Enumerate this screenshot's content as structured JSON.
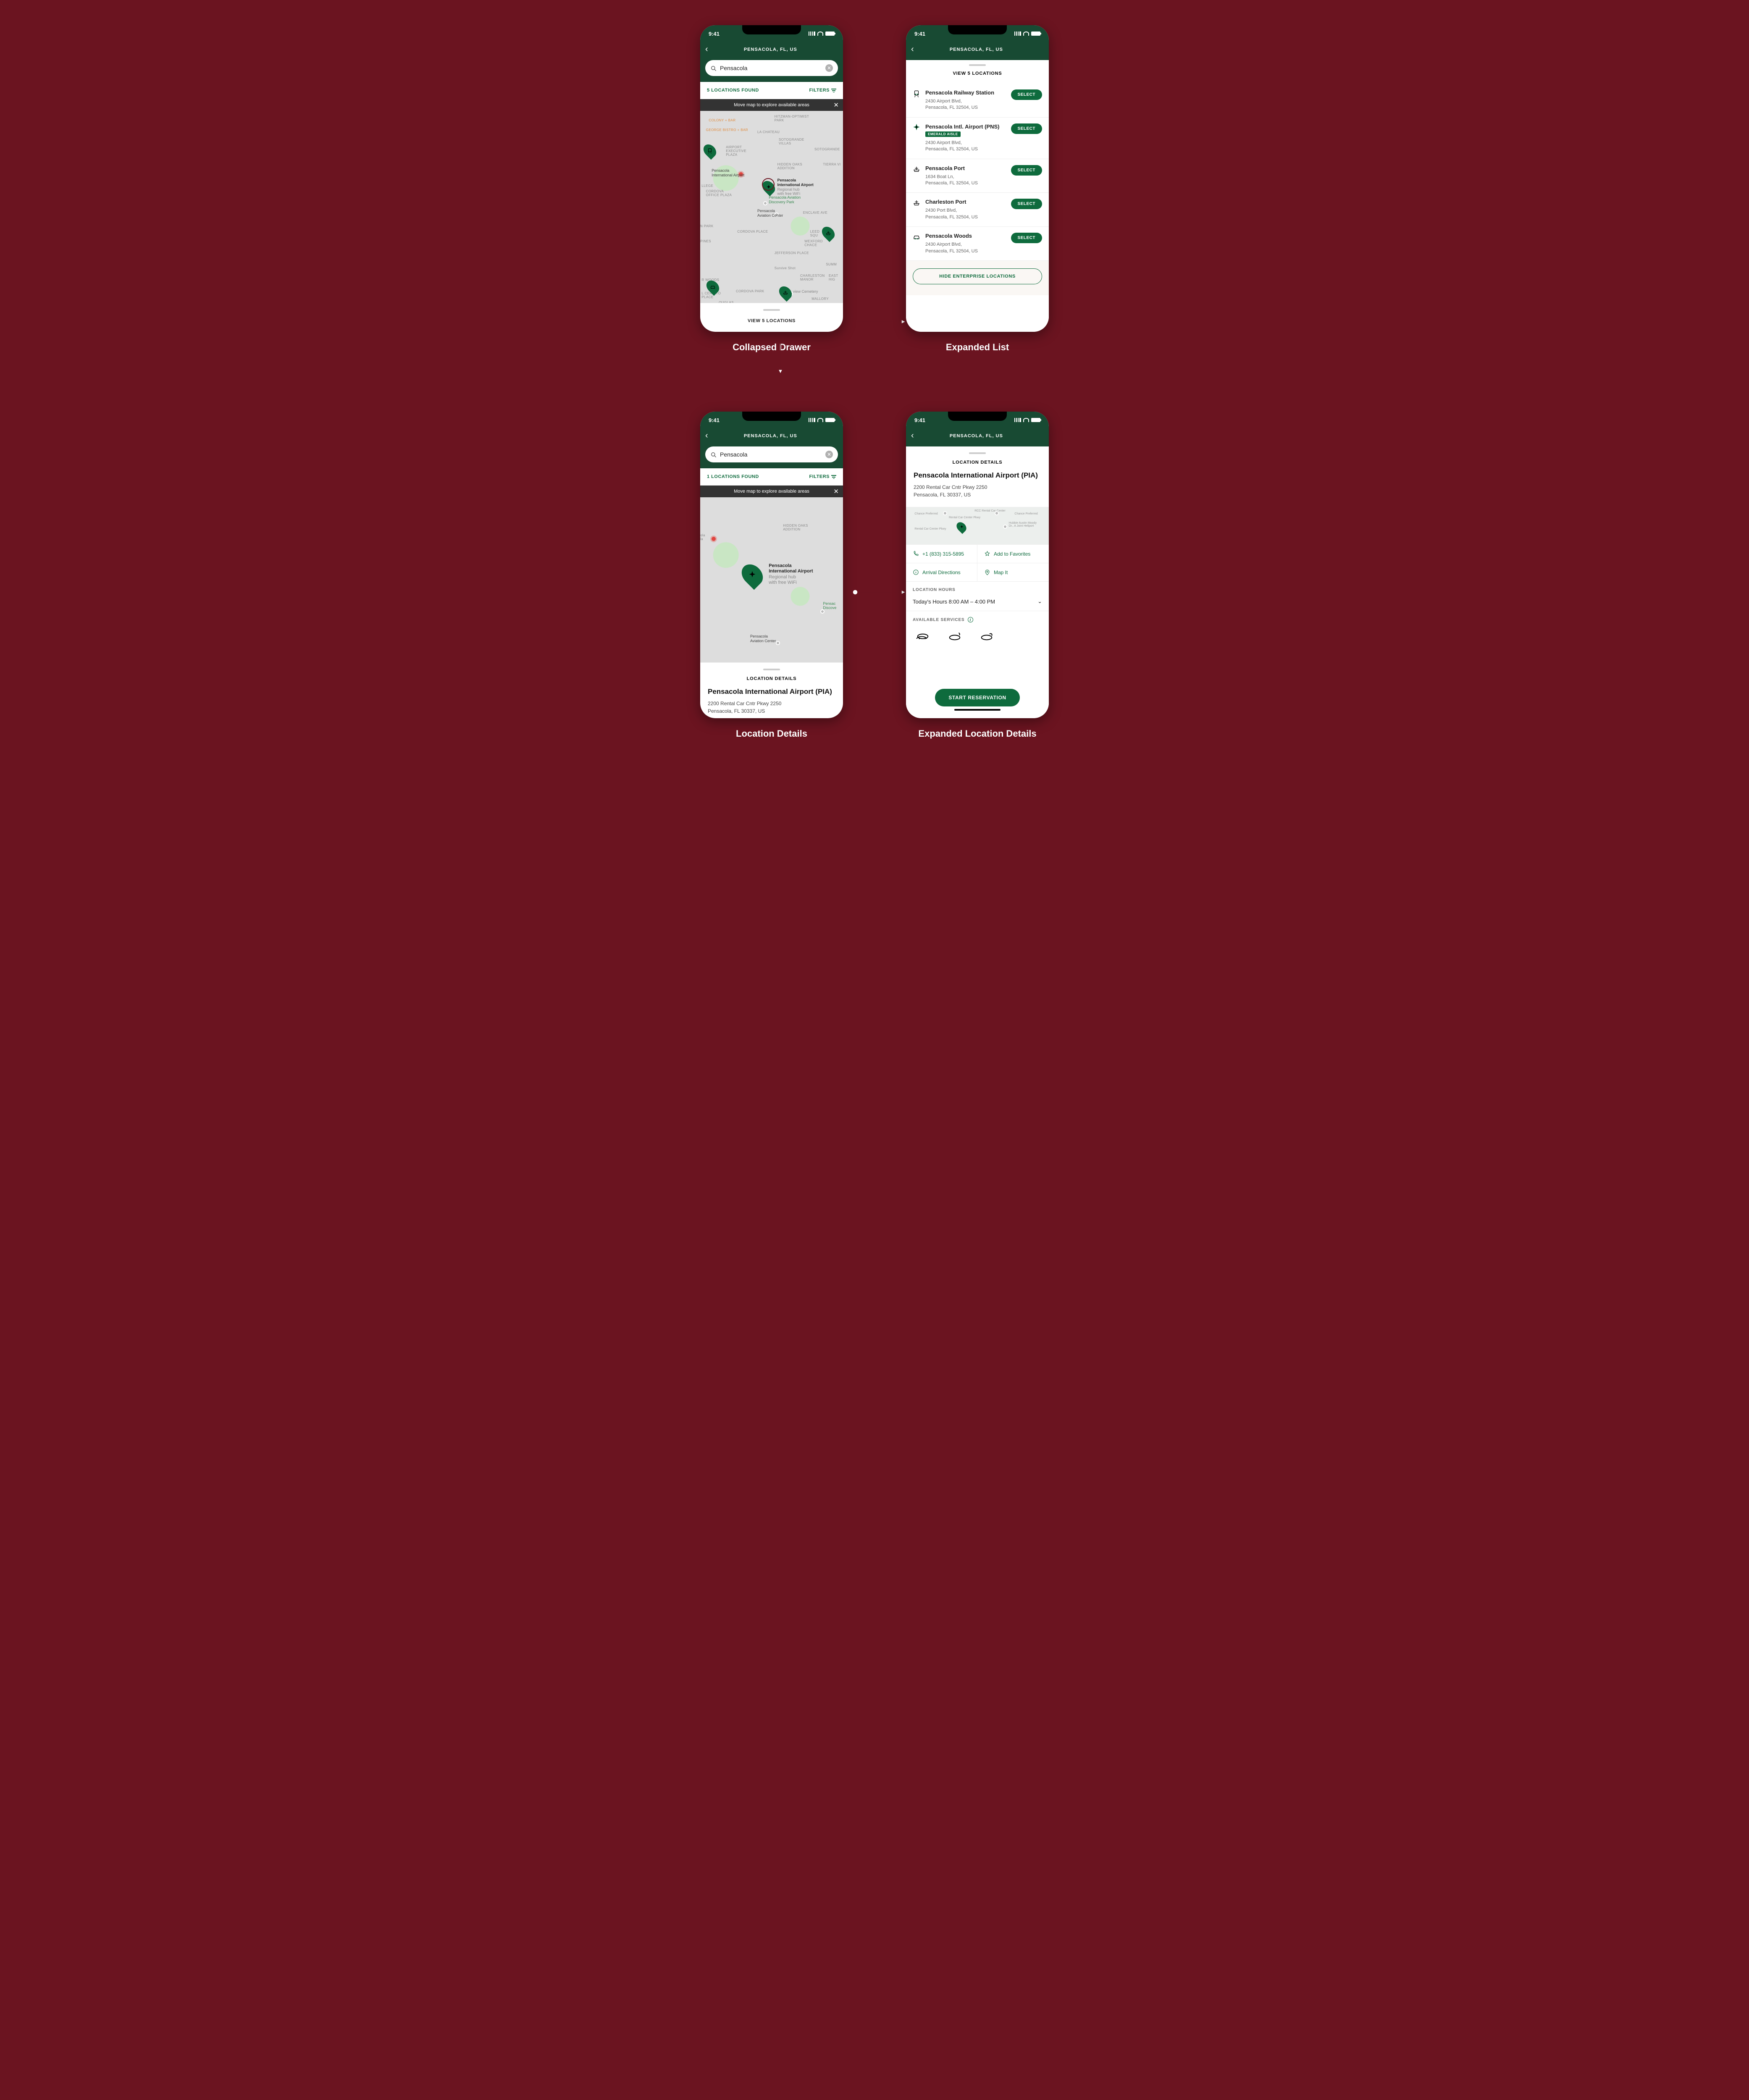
{
  "status": {
    "time": "9:41"
  },
  "header": {
    "title": "PENSACOLA, FL, US"
  },
  "search": {
    "value": "Pensacola"
  },
  "s1": {
    "found_text": "5 LOCATIONS FOUND",
    "filters_label": "FILTERS",
    "banner_text": "Move map to explore available areas",
    "drawer_link": "VIEW 5 LOCATIONS",
    "labels": {
      "airport_plaza": "AIRPORT\nEXECUTIVE\nPLAZA",
      "hidden_oaks": "HIDDEN OAKS\nADDITION",
      "sotogrande": "SOTOGRANDE\nVILLAS",
      "sotogrande2": "SOTOGRANDE",
      "tierra": "TIERRA VI",
      "cordova_office": "CORDOVA\nOFFICE PLAZA",
      "enclave": "ENCLAVE AVE",
      "cordova_place": "CORDOVA PLACE",
      "wexford": "WEXFORD\nCHACE",
      "jefferson": "JEFFERSON PLACE",
      "charleston": "CHARLESTON\nMANOR",
      "npark": "N PARK",
      "pines": "PINES",
      "summ": "SUMM",
      "east": "EAST\nHIG",
      "leed": "LEED\nSQU",
      "r_woods": "R WOODS",
      "mallory": "MALLORY",
      "lcerrito": "L CERRITO\nPLACE",
      "cordova_park": "CORDOVA PARK",
      "ouglas": "OUGLAS",
      "llege": "llege",
      "lachateau": "LA CHATEAU",
      "hitzman": "Hitzman-Optimist\nPark",
      "colony": "Colony + Bar",
      "bistro": "George Bistro + Bar"
    },
    "pin_labels": {
      "airport": "Pensacola\nInternational Airport",
      "airport_sub": "Regional hub\nwith free WiFi",
      "aviation": "Pensacola Aviation\nDiscovery Park",
      "aviation_center": "Pensacola\nAviation Center",
      "cemetery": "view Cemetery",
      "survive": "Survive Shot"
    }
  },
  "s2": {
    "sheet_title": "VIEW 5 LOCATIONS",
    "select_label": "SELECT",
    "hide_label": "HIDE ENTERPRISE LOCATIONS",
    "locations": [
      {
        "icon": "rail",
        "name": "Pensacola Railway Station",
        "addr1": "2430 Airport Blvd,",
        "addr2": "Pensacola, FL 32504, US"
      },
      {
        "icon": "plane",
        "name": "Pensacola Intl. Airport (PNS)",
        "badge": "EMERALD AISLE",
        "addr1": "2430 Airport Blvd,",
        "addr2": "Pensacola, FL 32504, US"
      },
      {
        "icon": "port",
        "name": "Pensacola Port",
        "addr1": "1634 Boat Ln,",
        "addr2": "Pensacola, FL 32504, US"
      },
      {
        "icon": "port",
        "name": "Charleston Port",
        "addr1": "2430 Port Blvd,",
        "addr2": "Pensacola, FL 32504, US"
      },
      {
        "icon": "car",
        "name": "Pensacola Woods",
        "addr1": "2430 Airport Blvd,",
        "addr2": "Pensacola, FL 32504, US"
      }
    ]
  },
  "s3": {
    "found_text": "1 LOCATIONS FOUND",
    "filters_label": "FILTERS",
    "banner_text": "Move map to explore available areas",
    "det_section": "LOCATION DETAILS",
    "det_name": "Pensacola International Airport (PIA)",
    "det_addr1": "2200 Rental Car Cntr Pkwy 2250",
    "det_addr2": "Pensacola, FL 30337, US",
    "labels": {
      "hidden_oaks": "HIDDEN OAKS\nADDITION",
      "discover": "Pensac\nDiscove",
      "aviation": "Pensacola\nAviation Center",
      "ola": "ola",
      "la": "la"
    },
    "pin": {
      "title": "Pensacola\nInternational Airport",
      "sub": "Regional hub\nwith free WiFi"
    }
  },
  "s4": {
    "det_section": "LOCATION DETAILS",
    "det_name": "Pensacola International Airport (PIA)",
    "det_addr1": "2200 Rental Car Cntr Pkwy 2250",
    "det_addr2": "Pensacola, FL 30337, US",
    "phone": "+1 (833) 315-5895",
    "fav": "Add to Favorites",
    "arr": "Arrival Directions",
    "mapit": "Map It",
    "hours_head": "LOCATION HOURS",
    "hours_text": "Today's Hours  8:00 AM – 4:00 PM",
    "services_head": "AVAILABLE SERVICES",
    "cta": "START RESERVATION",
    "mini_labels": {
      "rcc": "RCC Rental Car Center",
      "pkwy": "Rental Car Center Pkwy",
      "pkwy2": "Rental Car Center Pkwy",
      "hubbie": "Hubbie Austin Moody\nDr., A Joint Heliport",
      "chance": "Chance Preferred",
      "chance2": "Chance Preferred"
    }
  },
  "captions": {
    "s1": "Collapsed Drawer",
    "s2": "Expanded List",
    "s3": "Location Details",
    "s4": "Expanded Location Details"
  }
}
